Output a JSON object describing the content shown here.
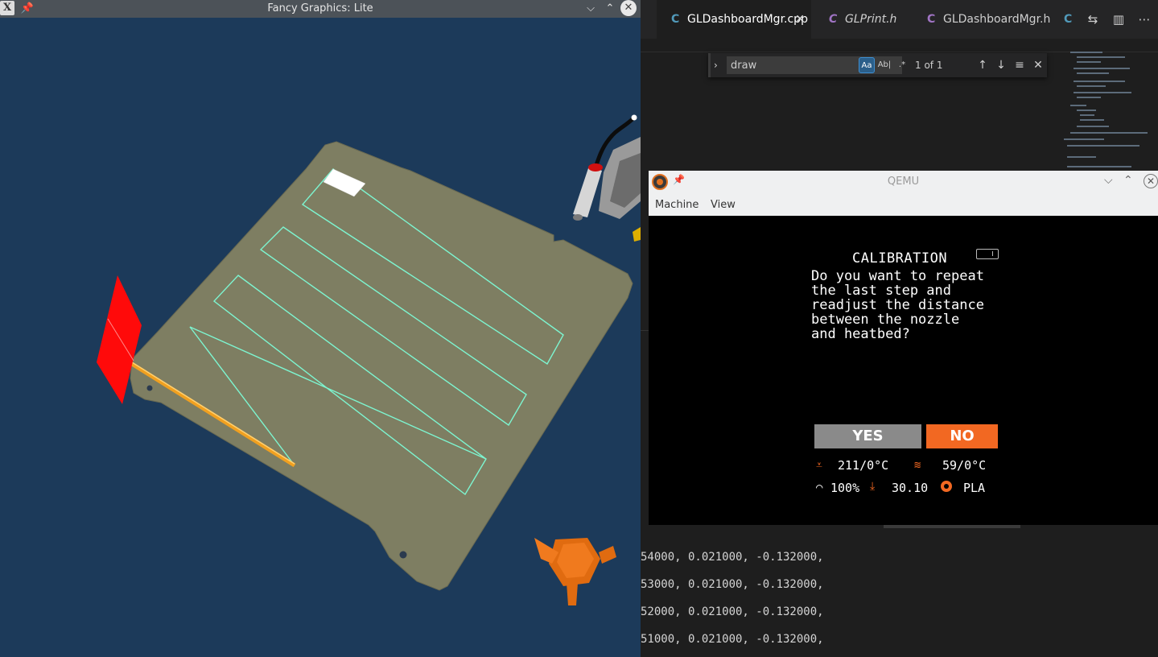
{
  "fancy_graphics": {
    "title": "Fancy Graphics: Lite",
    "app_icon": "X",
    "pin_icon": "📌",
    "minimize_icon": "⌵",
    "maximize_icon": "⌃",
    "close_icon": "✕"
  },
  "vscode": {
    "tabs": [
      {
        "icon": "C",
        "label": "GLDashboardMgr.cpp",
        "close": "✕"
      },
      {
        "icon": "C",
        "label": "GLPrint.h"
      },
      {
        "icon": "C",
        "label": "GLDashboardMgr.h"
      },
      {
        "icon": "C",
        "label": ""
      }
    ],
    "actions": [
      "⇆",
      "▥",
      "⋯"
    ],
    "find": {
      "toggle_icon": "›",
      "query": "draw",
      "match_case": "Aa",
      "whole_word": "Ab|",
      "regex": ".*",
      "count": "1 of 1",
      "prev_icon": "↑",
      "next_icon": "↓",
      "selection_icon": "≡",
      "close_icon": "✕"
    },
    "code_lines": [
      "54000, 0.021000, -0.132000,",
      "53000, 0.021000, -0.132000,",
      "52000, 0.021000, -0.132000,",
      "51000, 0.021000, -0.132000,"
    ]
  },
  "qemu": {
    "title": "QEMU",
    "menu": {
      "machine": "Machine",
      "view": "View"
    },
    "pin_icon": "📌",
    "minimize_icon": "⌵",
    "maximize_icon": "⌃",
    "close_icon": "✕",
    "lcd": {
      "title": "CALIBRATION",
      "message": "Do you want to repeat\nthe last step and\nreadjust the distance\nbetween the nozzle\nand heatbed?",
      "yes": "YES",
      "no": "NO",
      "nozzle_icon": "⩡",
      "nozzle_temp": "211/0°C",
      "bed_icon": "≋",
      "bed_temp": "59/0°C",
      "speed_icon": "◠",
      "speed": "100%",
      "z_icon": "⤓",
      "z_height": "30.10",
      "filament": "PLA"
    }
  },
  "colors": {
    "fg_background": "#1c3a5a",
    "bed": "#7e7e62",
    "toolpath": "#7df5d0",
    "lcd_accent": "#f26822",
    "lcd_yes": "#8a8a8a"
  }
}
